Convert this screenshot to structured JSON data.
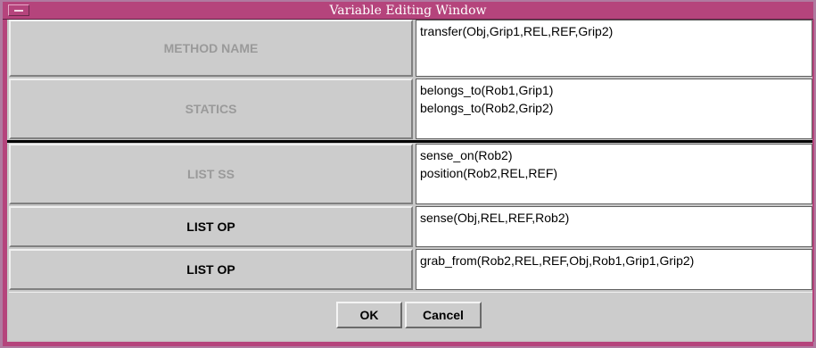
{
  "window": {
    "title": "Variable Editing Window"
  },
  "rows": [
    {
      "label": "METHOD NAME",
      "value": "transfer(Obj,Grip1,REL,REF,Grip2)"
    },
    {
      "label": "STATICS",
      "value": "belongs_to(Rob1,Grip1)\nbelongs_to(Rob2,Grip2)"
    },
    {
      "label": "LIST SS",
      "value": "sense_on(Rob2)\nposition(Rob2,REL,REF)"
    },
    {
      "label": "LIST OP",
      "value": "sense(Obj,REL,REF,Rob2)"
    },
    {
      "label": "LIST OP",
      "value": "grab_from(Rob2,REL,REF,Obj,Rob1,Grip1,Grip2)"
    }
  ],
  "buttons": {
    "ok": "OK",
    "cancel": "Cancel"
  },
  "colors": {
    "titlebar": "#b5447c",
    "panel": "#cccccc",
    "dim_label": "#9a9a9a"
  }
}
